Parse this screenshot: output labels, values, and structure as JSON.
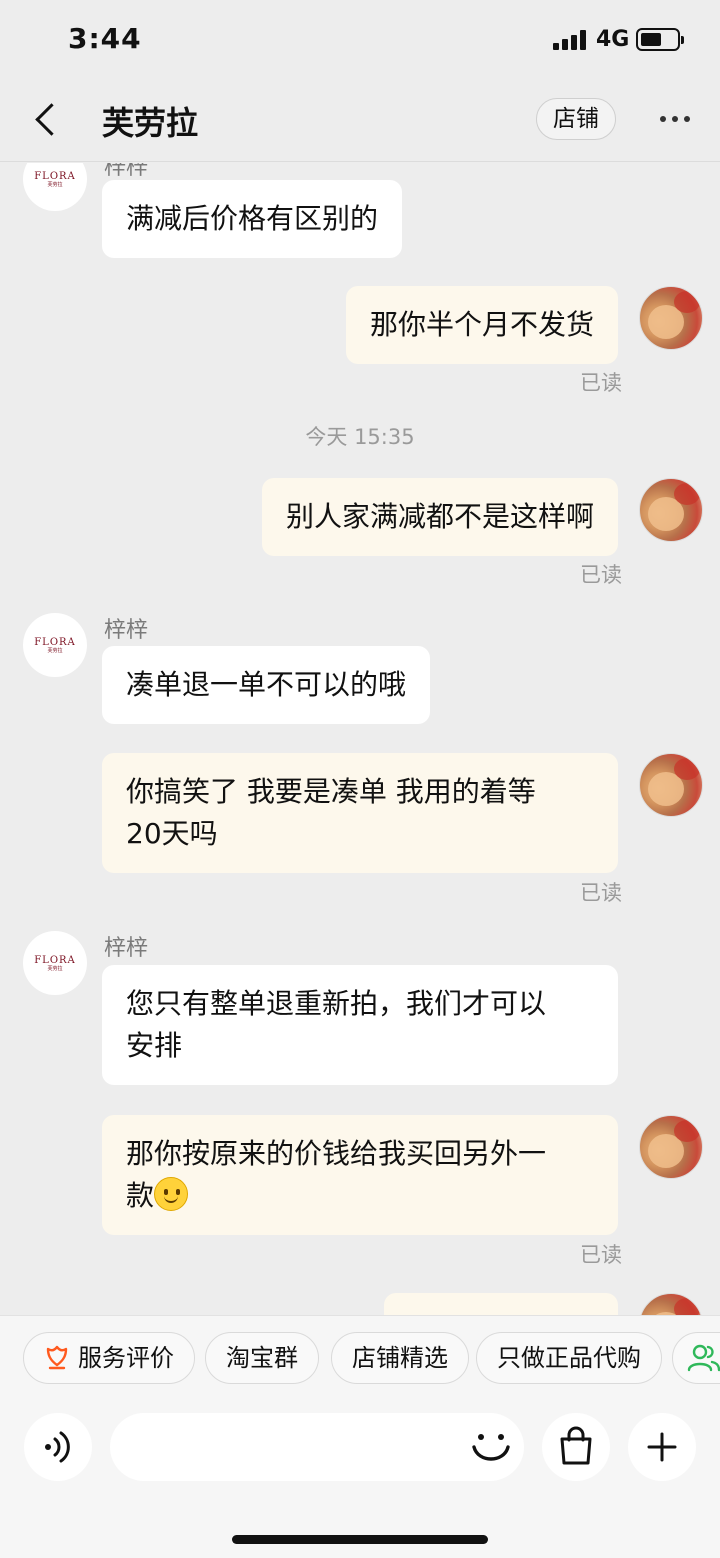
{
  "status_bar": {
    "time": "3:44",
    "network": "4G"
  },
  "header": {
    "title": "芙劳拉",
    "store_button": "店铺"
  },
  "shop_avatar": {
    "logo_text": "FLORA",
    "logo_subtext": "芙劳拉"
  },
  "messages": [
    {
      "side": "in",
      "sender": "梓梓",
      "text": "满减后价格有区别的"
    },
    {
      "side": "out",
      "text": "那你半个月不发货",
      "status": "已读"
    },
    {
      "side": "out",
      "text": "别人家满减都不是这样啊",
      "status": "已读"
    },
    {
      "side": "in",
      "sender": "梓梓",
      "text": "凑单退一单不可以的哦"
    },
    {
      "side": "out",
      "line1": "你搞笑了 我要是凑单 我用的着等",
      "line2": "20天吗",
      "status": "已读"
    },
    {
      "side": "in",
      "sender": "梓梓",
      "line1": "您只有整单退重新拍，我们才可以",
      "line2": "安排"
    },
    {
      "side": "out",
      "line1": "那你按原来的价钱给我买回另外一",
      "line2": "款",
      "emoji": "slightly-smiling-face",
      "status": "已读"
    }
  ],
  "timestamp": "今天 15:35",
  "quick_actions": [
    "服务评价",
    "淘宝群",
    "店铺精选",
    "只做正品代购"
  ],
  "input": {
    "placeholder": ""
  },
  "icons": {
    "back": "chevron-left-icon",
    "more": "more-dots-icon",
    "voice": "voice-icon",
    "emoji": "smile-icon",
    "bag": "shopping-bag-icon",
    "plus": "plus-icon",
    "service": "flower-icon",
    "group": "people-icon"
  },
  "colors": {
    "background": "#ededed",
    "incoming_bubble": "#ffffff",
    "outgoing_bubble": "#fdf8ec",
    "accent_orange": "#ff5a1f",
    "accent_green": "#2fb85a"
  }
}
